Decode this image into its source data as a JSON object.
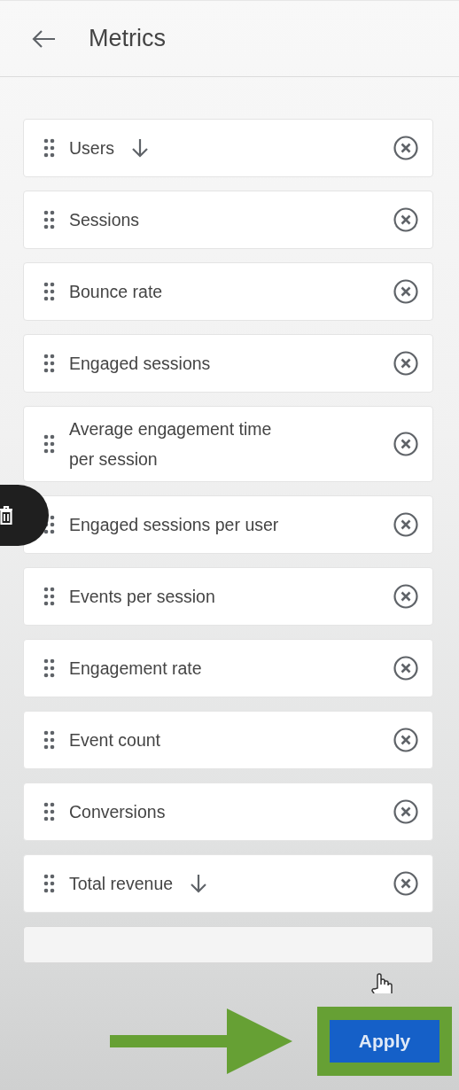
{
  "header": {
    "title": "Metrics"
  },
  "metrics": [
    {
      "label": "Users",
      "sort_descending": true
    },
    {
      "label": "Sessions",
      "sort_descending": false
    },
    {
      "label": "Bounce rate",
      "sort_descending": false
    },
    {
      "label": "Engaged sessions",
      "sort_descending": false
    },
    {
      "label": "Average engagement time per session",
      "sort_descending": false
    },
    {
      "label": "Engaged sessions per user",
      "sort_descending": false
    },
    {
      "label": "Events per session",
      "sort_descending": false
    },
    {
      "label": "Engagement rate",
      "sort_descending": false
    },
    {
      "label": "Event count",
      "sort_descending": false
    },
    {
      "label": "Conversions",
      "sort_descending": false
    },
    {
      "label": "Total revenue",
      "sort_descending": true
    }
  ],
  "footer": {
    "apply_button": "Apply"
  }
}
